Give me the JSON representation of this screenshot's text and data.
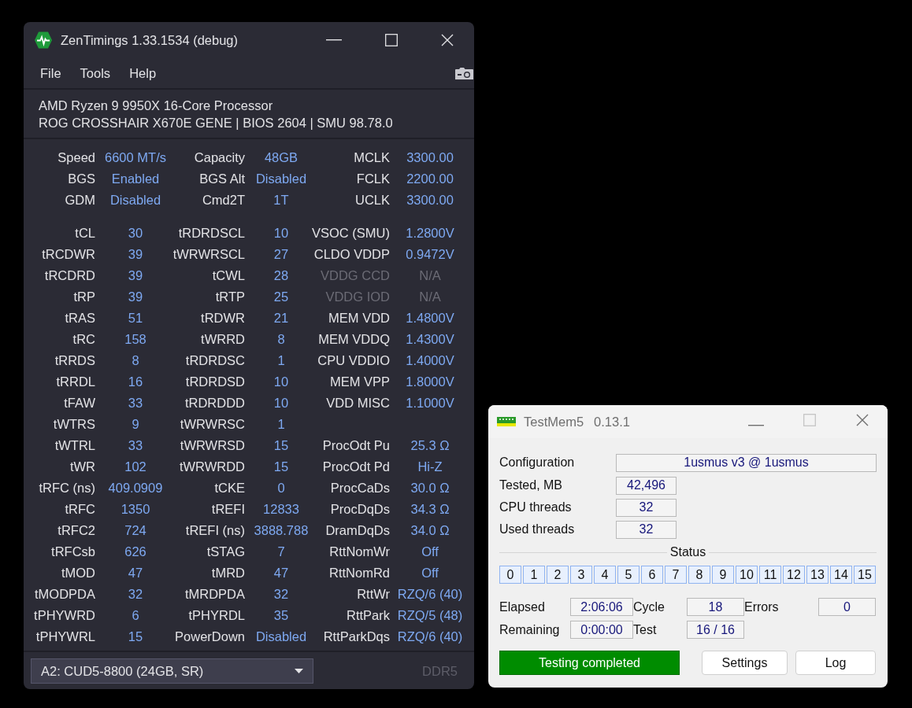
{
  "zentimings": {
    "title": "ZenTimings 1.33.1534 (debug)",
    "menu": [
      "File",
      "Tools",
      "Help"
    ],
    "cpu": "AMD Ryzen 9 9950X 16-Core Processor",
    "board": "ROG CROSSHAIR X670E GENE | BIOS 2604 | SMU 98.78.0",
    "summary": [
      [
        {
          "label": "Speed",
          "value": "6600 MT/s",
          "disabled": false
        },
        {
          "label": "Capacity",
          "value": "48GB",
          "disabled": false
        },
        {
          "label": "MCLK",
          "value": "3300.00",
          "disabled": false
        }
      ],
      [
        {
          "label": "BGS",
          "value": "Enabled",
          "disabled": false
        },
        {
          "label": "BGS Alt",
          "value": "Disabled",
          "disabled": false
        },
        {
          "label": "FCLK",
          "value": "2200.00",
          "disabled": false
        }
      ],
      [
        {
          "label": "GDM",
          "value": "Disabled",
          "disabled": false
        },
        {
          "label": "Cmd2T",
          "value": "1T",
          "disabled": false
        },
        {
          "label": "UCLK",
          "value": "3300.00",
          "disabled": false
        }
      ]
    ],
    "timings": [
      [
        {
          "label": "tCL",
          "value": "30",
          "disabled": false
        },
        {
          "label": "tRDRDSCL",
          "value": "10",
          "disabled": false
        },
        {
          "label": "VSOC (SMU)",
          "value": "1.2800V",
          "disabled": false
        }
      ],
      [
        {
          "label": "tRCDWR",
          "value": "39",
          "disabled": false
        },
        {
          "label": "tWRWRSCL",
          "value": "27",
          "disabled": false
        },
        {
          "label": "CLDO VDDP",
          "value": "0.9472V",
          "disabled": false
        }
      ],
      [
        {
          "label": "tRCDRD",
          "value": "39",
          "disabled": false
        },
        {
          "label": "tCWL",
          "value": "28",
          "disabled": false
        },
        {
          "label": "VDDG CCD",
          "value": "N/A",
          "disabled": true
        }
      ],
      [
        {
          "label": "tRP",
          "value": "39",
          "disabled": false
        },
        {
          "label": "tRTP",
          "value": "25",
          "disabled": false
        },
        {
          "label": "VDDG IOD",
          "value": "N/A",
          "disabled": true
        }
      ],
      [
        {
          "label": "tRAS",
          "value": "51",
          "disabled": false
        },
        {
          "label": "tRDWR",
          "value": "21",
          "disabled": false
        },
        {
          "label": "MEM VDD",
          "value": "1.4800V",
          "disabled": false
        }
      ],
      [
        {
          "label": "tRC",
          "value": "158",
          "disabled": false
        },
        {
          "label": "tWRRD",
          "value": "8",
          "disabled": false
        },
        {
          "label": "MEM VDDQ",
          "value": "1.4300V",
          "disabled": false
        }
      ],
      [
        {
          "label": "tRRDS",
          "value": "8",
          "disabled": false
        },
        {
          "label": "tRDRDSC",
          "value": "1",
          "disabled": false
        },
        {
          "label": "CPU VDDIO",
          "value": "1.4000V",
          "disabled": false
        }
      ],
      [
        {
          "label": "tRRDL",
          "value": "16",
          "disabled": false
        },
        {
          "label": "tRDRDSD",
          "value": "10",
          "disabled": false
        },
        {
          "label": "MEM VPP",
          "value": "1.8000V",
          "disabled": false
        }
      ],
      [
        {
          "label": "tFAW",
          "value": "33",
          "disabled": false
        },
        {
          "label": "tRDRDDD",
          "value": "10",
          "disabled": false
        },
        {
          "label": "VDD MISC",
          "value": "1.1000V",
          "disabled": false
        }
      ],
      [
        {
          "label": "tWTRS",
          "value": "9",
          "disabled": false
        },
        {
          "label": "tWRWRSC",
          "value": "1",
          "disabled": false
        }
      ],
      [
        {
          "label": "tWTRL",
          "value": "33",
          "disabled": false
        },
        {
          "label": "tWRWRSD",
          "value": "15",
          "disabled": false
        },
        {
          "label": "ProcOdt Pu",
          "value": "25.3 Ω",
          "disabled": false
        }
      ],
      [
        {
          "label": "tWR",
          "value": "102",
          "disabled": false
        },
        {
          "label": "tWRWRDD",
          "value": "15",
          "disabled": false
        },
        {
          "label": "ProcOdt Pd",
          "value": "Hi-Z",
          "disabled": false
        }
      ],
      [
        {
          "label": "tRFC (ns)",
          "value": "409.0909",
          "disabled": false
        },
        {
          "label": "tCKE",
          "value": "0",
          "disabled": false
        },
        {
          "label": "ProcCaDs",
          "value": "30.0 Ω",
          "disabled": false
        }
      ],
      [
        {
          "label": "tRFC",
          "value": "1350",
          "disabled": false
        },
        {
          "label": "tREFI",
          "value": "12833",
          "disabled": false
        },
        {
          "label": "ProcDqDs",
          "value": "34.3 Ω",
          "disabled": false
        }
      ],
      [
        {
          "label": "tRFC2",
          "value": "724",
          "disabled": false
        },
        {
          "label": "tREFI (ns)",
          "value": "3888.788",
          "disabled": false
        },
        {
          "label": "DramDqDs",
          "value": "34.0 Ω",
          "disabled": false
        }
      ],
      [
        {
          "label": "tRFCsb",
          "value": "626",
          "disabled": false
        },
        {
          "label": "tSTAG",
          "value": "7",
          "disabled": false
        },
        {
          "label": "RttNomWr",
          "value": "Off",
          "disabled": false
        }
      ],
      [
        {
          "label": "tMOD",
          "value": "47",
          "disabled": false
        },
        {
          "label": "tMRD",
          "value": "47",
          "disabled": false
        },
        {
          "label": "RttNomRd",
          "value": "Off",
          "disabled": false
        }
      ],
      [
        {
          "label": "tMODPDA",
          "value": "32",
          "disabled": false
        },
        {
          "label": "tMRDPDA",
          "value": "32",
          "disabled": false
        },
        {
          "label": "RttWr",
          "value": "RZQ/6 (40)",
          "disabled": false
        }
      ],
      [
        {
          "label": "tPHYWRD",
          "value": "6",
          "disabled": false
        },
        {
          "label": "tPHYRDL",
          "value": "35",
          "disabled": false
        },
        {
          "label": "RttPark",
          "value": "RZQ/5 (48)",
          "disabled": false
        }
      ],
      [
        {
          "label": "tPHYWRL",
          "value": "15",
          "disabled": false
        },
        {
          "label": "PowerDown",
          "value": "Disabled",
          "disabled": false
        },
        {
          "label": "RttParkDqs",
          "value": "RZQ/6 (40)",
          "disabled": false
        }
      ]
    ],
    "dimm_select": {
      "value": "A2: CUD5-8800 (24GB, SR)"
    },
    "memory_type": "DDR5"
  },
  "testmem5": {
    "title": "TestMem5",
    "version": "0.13.1",
    "info": [
      {
        "label": "Configuration",
        "value": "1usmus v3 @ 1usmus"
      },
      {
        "label": "Tested, MB",
        "value": "42,496"
      },
      {
        "label": "CPU threads",
        "value": "32"
      },
      {
        "label": "Used threads",
        "value": "32"
      }
    ],
    "status_heading": "Status",
    "threads": [
      "0",
      "1",
      "2",
      "3",
      "4",
      "5",
      "6",
      "7",
      "8",
      "9",
      "10",
      "11",
      "12",
      "13",
      "14",
      "15"
    ],
    "stats": [
      {
        "label": "Elapsed",
        "value": "2:06:06"
      },
      {
        "label": "Cycle",
        "value": "18"
      },
      {
        "label": "Errors",
        "value": "0"
      },
      {
        "label": "Remaining",
        "value": "0:00:00"
      },
      {
        "label": "Test",
        "value": "16 / 16"
      }
    ],
    "status_message": "Testing completed",
    "buttons": [
      "Settings",
      "Log"
    ]
  }
}
